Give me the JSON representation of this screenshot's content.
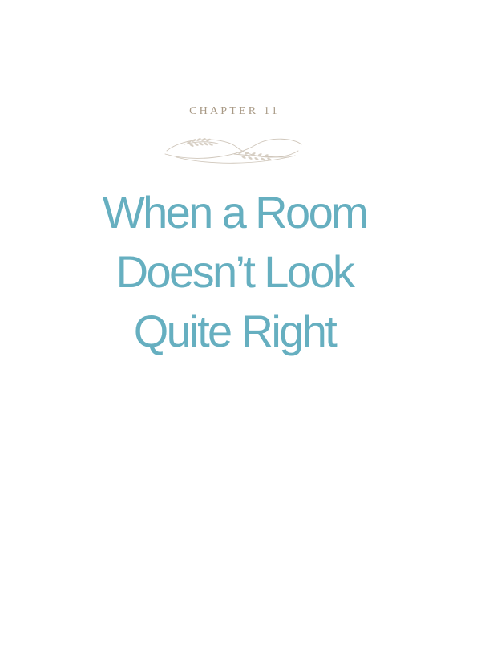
{
  "chapter": {
    "label": "CHAPTER 11"
  },
  "ornament": {
    "icon": "laurel-flourish-icon",
    "color": "#cfc6ba"
  },
  "title": {
    "lines": [
      "When a Room",
      "Doesn’t Look",
      "Quite Right"
    ],
    "color": "#66afc0"
  }
}
